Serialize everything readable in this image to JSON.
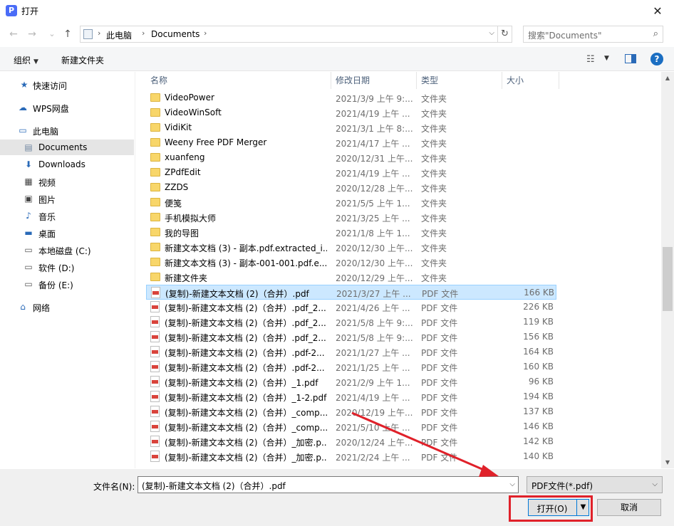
{
  "window": {
    "title": "打开",
    "app_icon_letter": "P",
    "close_glyph": "✕"
  },
  "nav": {
    "back": "←",
    "forward": "→",
    "recent": "⌄",
    "up": "↑"
  },
  "address": {
    "segments": [
      "此电脑",
      "Documents"
    ],
    "chevron": "›",
    "dropdown": "⌵",
    "refresh": "↻"
  },
  "search": {
    "placeholder": "搜索\"Documents\"",
    "icon": "⌕"
  },
  "toolbar": {
    "organize": "组织",
    "organize_caret": "▼",
    "new_folder": "新建文件夹",
    "view_icon": "☷",
    "view_caret": "▼",
    "help": "?"
  },
  "sidebar": {
    "items": [
      {
        "label": "快速访问",
        "icon": "★",
        "color": "#2a6ab8"
      },
      {
        "label": "WPS网盘",
        "icon": "☁",
        "color": "#2a6ab8"
      },
      {
        "label": "此电脑",
        "icon": "▭",
        "color": "#2a6ab8"
      },
      {
        "label": "Documents",
        "icon": "▤",
        "color": "#6f86a0"
      },
      {
        "label": "Downloads",
        "icon": "⬇",
        "color": "#2a6ab8"
      },
      {
        "label": "视频",
        "icon": "▦",
        "color": "#444444"
      },
      {
        "label": "图片",
        "icon": "▣",
        "color": "#444444"
      },
      {
        "label": "音乐",
        "icon": "♪",
        "color": "#2a6ab8"
      },
      {
        "label": "桌面",
        "icon": "▬",
        "color": "#2a6ab8"
      },
      {
        "label": "本地磁盘 (C:)",
        "icon": "▭",
        "color": "#555555"
      },
      {
        "label": "软件 (D:)",
        "icon": "▭",
        "color": "#555555"
      },
      {
        "label": "备份 (E:)",
        "icon": "▭",
        "color": "#555555"
      },
      {
        "label": "网络",
        "icon": "⌂",
        "color": "#2a6ab8"
      }
    ]
  },
  "columns": {
    "name": "名称",
    "date": "修改日期",
    "type": "类型",
    "size": "大小",
    "sort_arrow": "^"
  },
  "files": [
    {
      "name": "VideoPower",
      "date": "2021/3/9 上午 9:...",
      "type": "文件夹",
      "size": "",
      "kind": "folder"
    },
    {
      "name": "VideoWinSoft",
      "date": "2021/4/19 上午 ...",
      "type": "文件夹",
      "size": "",
      "kind": "folder"
    },
    {
      "name": "VidiKit",
      "date": "2021/3/1 上午 8:...",
      "type": "文件夹",
      "size": "",
      "kind": "folder"
    },
    {
      "name": "Weeny Free PDF Merger",
      "date": "2021/4/17 上午 ...",
      "type": "文件夹",
      "size": "",
      "kind": "folder"
    },
    {
      "name": "xuanfeng",
      "date": "2020/12/31 上午...",
      "type": "文件夹",
      "size": "",
      "kind": "folder"
    },
    {
      "name": "ZPdfEdit",
      "date": "2021/4/19 上午 ...",
      "type": "文件夹",
      "size": "",
      "kind": "folder"
    },
    {
      "name": "ZZDS",
      "date": "2020/12/28 上午...",
      "type": "文件夹",
      "size": "",
      "kind": "folder"
    },
    {
      "name": "便笺",
      "date": "2021/5/5 上午 1...",
      "type": "文件夹",
      "size": "",
      "kind": "folder"
    },
    {
      "name": "手机模拟大师",
      "date": "2021/3/25 上午 ...",
      "type": "文件夹",
      "size": "",
      "kind": "folder"
    },
    {
      "name": "我的导图",
      "date": "2021/1/8 上午 1...",
      "type": "文件夹",
      "size": "",
      "kind": "folder"
    },
    {
      "name": "新建文本文档 (3) - 副本.pdf.extracted_i...",
      "date": "2020/12/30 上午...",
      "type": "文件夹",
      "size": "",
      "kind": "folder"
    },
    {
      "name": "新建文本文档 (3) - 副本-001-001.pdf.e...",
      "date": "2020/12/30 上午...",
      "type": "文件夹",
      "size": "",
      "kind": "folder"
    },
    {
      "name": "新建文件夹",
      "date": "2020/12/29 上午...",
      "type": "文件夹",
      "size": "",
      "kind": "folder"
    },
    {
      "name": "(复制)-新建文本文档 (2)（合并）.pdf",
      "date": "2021/3/27 上午 ...",
      "type": "PDF 文件",
      "size": "166 KB",
      "kind": "pdf",
      "selected": true
    },
    {
      "name": "(复制)-新建文本文档 (2)（合并）.pdf_2...",
      "date": "2021/4/26 上午 ...",
      "type": "PDF 文件",
      "size": "226 KB",
      "kind": "pdf"
    },
    {
      "name": "(复制)-新建文本文档 (2)（合并）.pdf_2...",
      "date": "2021/5/8 上午 9:...",
      "type": "PDF 文件",
      "size": "119 KB",
      "kind": "pdf"
    },
    {
      "name": "(复制)-新建文本文档 (2)（合并）.pdf_2...",
      "date": "2021/5/8 上午 9:...",
      "type": "PDF 文件",
      "size": "156 KB",
      "kind": "pdf"
    },
    {
      "name": "(复制)-新建文本文档 (2)（合并）.pdf-2...",
      "date": "2021/1/27 上午 ...",
      "type": "PDF 文件",
      "size": "164 KB",
      "kind": "pdf"
    },
    {
      "name": "(复制)-新建文本文档 (2)（合并）.pdf-2...",
      "date": "2021/1/25 上午 ...",
      "type": "PDF 文件",
      "size": "160 KB",
      "kind": "pdf"
    },
    {
      "name": "(复制)-新建文本文档 (2)（合并）_1.pdf",
      "date": "2021/2/9 上午 1...",
      "type": "PDF 文件",
      "size": "96 KB",
      "kind": "pdf"
    },
    {
      "name": "(复制)-新建文本文档 (2)（合并）_1-2.pdf",
      "date": "2021/4/19 上午 ...",
      "type": "PDF 文件",
      "size": "194 KB",
      "kind": "pdf"
    },
    {
      "name": "(复制)-新建文本文档 (2)（合并）_comp...",
      "date": "2020/12/19 上午...",
      "type": "PDF 文件",
      "size": "137 KB",
      "kind": "pdf"
    },
    {
      "name": "(复制)-新建文本文档 (2)（合并）_comp...",
      "date": "2021/5/10 上午 ...",
      "type": "PDF 文件",
      "size": "146 KB",
      "kind": "pdf"
    },
    {
      "name": "(复制)-新建文本文档 (2)（合并）_加密.p...",
      "date": "2020/12/24 上午...",
      "type": "PDF 文件",
      "size": "142 KB",
      "kind": "pdf"
    },
    {
      "name": "(复制)-新建文本文档 (2)（合并）_加密.p...",
      "date": "2021/2/24 上午 ...",
      "type": "PDF 文件",
      "size": "140 KB",
      "kind": "pdf"
    }
  ],
  "scrollbar": {
    "up": "▲",
    "down": "▼"
  },
  "footer": {
    "filename_label": "文件名(N):",
    "filename_value": "(复制)-新建文本文档 (2)（合并）.pdf",
    "filename_caret": "⌵",
    "filetype_value": "PDF文件(*.pdf)",
    "filetype_caret": "⌵",
    "open_label": "打开(O)",
    "open_split": "▼",
    "cancel_label": "取消"
  },
  "annotation": {
    "color": "#e0212a"
  }
}
